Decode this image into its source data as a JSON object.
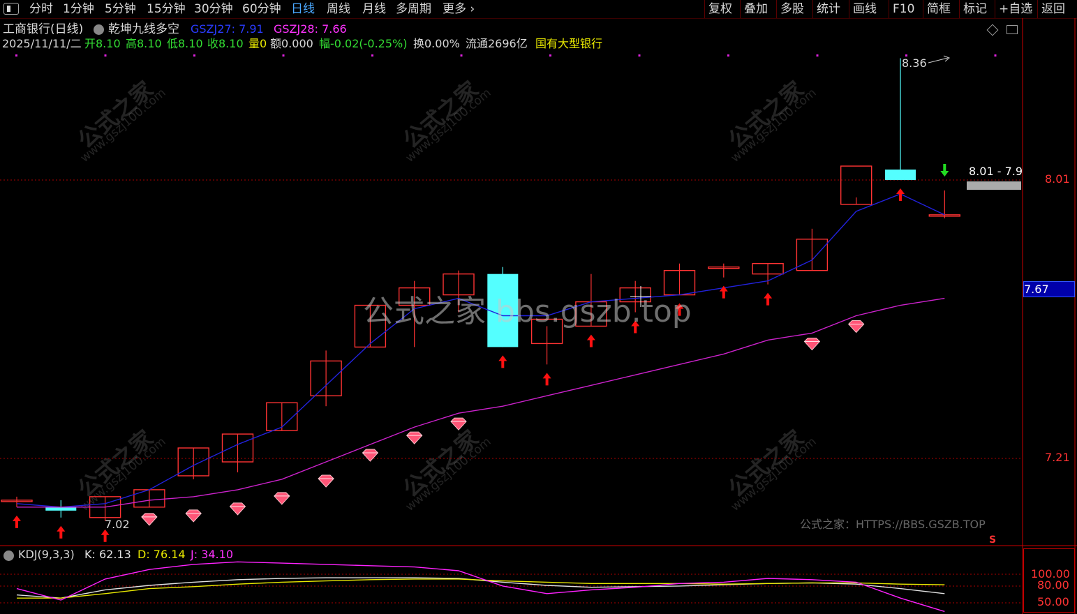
{
  "toolbar": {
    "periods": [
      {
        "label": "分时",
        "active": false
      },
      {
        "label": "1分钟",
        "active": false
      },
      {
        "label": "5分钟",
        "active": false
      },
      {
        "label": "15分钟",
        "active": false
      },
      {
        "label": "30分钟",
        "active": false
      },
      {
        "label": "60分钟",
        "active": false
      },
      {
        "label": "日线",
        "active": true
      },
      {
        "label": "周线",
        "active": false
      },
      {
        "label": "月线",
        "active": false
      },
      {
        "label": "多周期",
        "active": false
      },
      {
        "label": "更多",
        "active": false
      }
    ],
    "more_chevron": "›",
    "right_buttons": [
      "复权",
      "叠加",
      "多股",
      "统计",
      "画线",
      "F10",
      "简框",
      "标记",
      "+自选",
      "返回"
    ]
  },
  "header": {
    "stock_title": "工商银行(日线)",
    "indicator_name": "乾坤九线多空",
    "gszj27": "GSZJ27: 7.91",
    "gszj28": "GSZJ28: 7.66",
    "date": "2025/11/11/二",
    "open": "开8.10",
    "high": "高8.10",
    "low": "低8.10",
    "close": "收8.10",
    "volume": "量0",
    "amount": "额0.000",
    "change": "幅-0.02(-0.25%)",
    "turnover": "换0.00%",
    "float_cap": "流通2696亿",
    "industry": "国有大型银行"
  },
  "annotations": {
    "high_label": "8.36",
    "low_label": "7.02",
    "range_label": "8.01 - 7.9",
    "footer_url": "公式之家：HTTPS://BBS.GSZB.TOP",
    "s_marker": "S"
  },
  "watermarks": {
    "brand": "公式之家",
    "site": "www.gszj100.com",
    "center": "公式之家 bbs.gszb.top"
  },
  "axis": {
    "right_ticks": [
      "8.01",
      "7.21"
    ],
    "current_price_tag": "7.67",
    "kdj_ticks": [
      "100.00",
      "80.00",
      "50.00"
    ]
  },
  "kdj": {
    "title": "KDJ(9,3,3)",
    "k_label": "K: 62.13",
    "d_label": "D: 76.14",
    "j_label": "J: 34.10"
  },
  "colors": {
    "up": "#ff3333",
    "down": "#54ffff",
    "ma_blue": "#2222dd",
    "ma_magenta": "#cc22cc",
    "k_line": "#e0e0e0",
    "d_line": "#e8e800",
    "j_line": "#ff22ff"
  },
  "chart_data": {
    "type": "candlestick",
    "y_range_price": [
      6.9,
      8.45
    ],
    "candles": [
      {
        "o": 7.09,
        "h": 7.1,
        "l": 7.07,
        "c": 7.09
      },
      {
        "o": 7.07,
        "h": 7.09,
        "l": 7.04,
        "c": 7.06
      },
      {
        "o": 7.04,
        "h": 7.1,
        "l": 7.03,
        "c": 7.1
      },
      {
        "o": 7.07,
        "h": 7.12,
        "l": 7.07,
        "c": 7.12
      },
      {
        "o": 7.16,
        "h": 7.24,
        "l": 7.15,
        "c": 7.24
      },
      {
        "o": 7.2,
        "h": 7.28,
        "l": 7.17,
        "c": 7.28
      },
      {
        "o": 7.29,
        "h": 7.37,
        "l": 7.29,
        "c": 7.37
      },
      {
        "o": 7.39,
        "h": 7.52,
        "l": 7.36,
        "c": 7.49
      },
      {
        "o": 7.53,
        "h": 7.65,
        "l": 7.53,
        "c": 7.65
      },
      {
        "o": 7.65,
        "h": 7.72,
        "l": 7.53,
        "c": 7.7
      },
      {
        "o": 7.68,
        "h": 7.75,
        "l": 7.63,
        "c": 7.74
      },
      {
        "o": 7.74,
        "h": 7.76,
        "l": 7.53,
        "c": 7.53
      },
      {
        "o": 7.54,
        "h": 7.59,
        "l": 7.48,
        "c": 7.61
      },
      {
        "o": 7.59,
        "h": 7.74,
        "l": 7.59,
        "c": 7.66
      },
      {
        "o": 7.66,
        "h": 7.72,
        "l": 7.63,
        "c": 7.7
      },
      {
        "o": 7.68,
        "h": 7.77,
        "l": 7.68,
        "c": 7.75
      },
      {
        "o": 7.76,
        "h": 7.77,
        "l": 7.73,
        "c": 7.76
      },
      {
        "o": 7.74,
        "h": 7.77,
        "l": 7.71,
        "c": 7.77
      },
      {
        "o": 7.75,
        "h": 7.87,
        "l": 7.75,
        "c": 7.84
      },
      {
        "o": 7.94,
        "h": 7.96,
        "l": 7.94,
        "c": 8.05
      },
      {
        "o": 8.04,
        "h": 8.36,
        "l": 8.01,
        "c": 8.01
      },
      {
        "o": 7.91,
        "h": 7.98,
        "l": 7.9,
        "c": 7.91
      }
    ],
    "ma_blue": [
      7.08,
      7.07,
      7.08,
      7.12,
      7.19,
      7.25,
      7.3,
      7.42,
      7.54,
      7.64,
      7.67,
      7.62,
      7.62,
      7.66,
      7.67,
      7.68,
      7.7,
      7.72,
      7.78,
      7.92,
      7.97,
      7.91
    ],
    "ma_magenta": [
      7.07,
      7.07,
      7.07,
      7.09,
      7.1,
      7.12,
      7.15,
      7.2,
      7.25,
      7.3,
      7.34,
      7.36,
      7.39,
      7.42,
      7.45,
      7.48,
      7.51,
      7.55,
      7.57,
      7.62,
      7.65,
      7.67
    ],
    "signals": [
      "up",
      "up",
      "up",
      "gem",
      "gem",
      "gem",
      "gem",
      "gem",
      "gem",
      "gem",
      "gem",
      "up",
      "up",
      "up",
      "up",
      "up",
      "up",
      "up",
      "gem",
      "gem",
      "up",
      "down"
    ],
    "kdj_k": [
      60,
      55,
      68,
      75,
      80,
      84,
      86,
      87,
      87,
      87,
      86,
      80,
      75,
      72,
      73,
      74,
      76,
      78,
      79,
      77,
      70,
      62
    ],
    "kdj_d": [
      55,
      55,
      62,
      70,
      73,
      77,
      80,
      82,
      84,
      85,
      85,
      82,
      80,
      78,
      78,
      78,
      77,
      78,
      79,
      79,
      77,
      76
    ],
    "kdj_j": [
      70,
      52,
      85,
      100,
      108,
      112,
      110,
      108,
      106,
      104,
      98,
      74,
      62,
      68,
      72,
      78,
      80,
      86,
      84,
      80,
      55,
      34
    ],
    "kdj_range": [
      30,
      120
    ]
  }
}
